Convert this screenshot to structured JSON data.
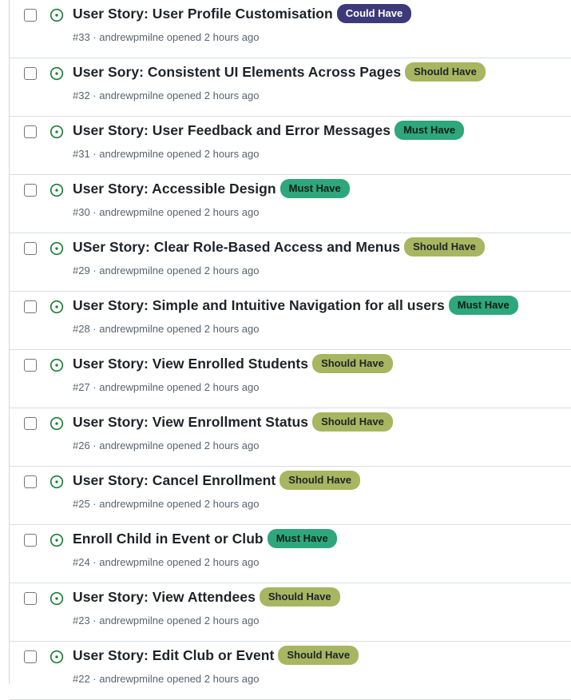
{
  "colors": {
    "open_icon": "#1a7f37",
    "label_could": "#3d3a7a",
    "label_should": "#a8b661",
    "label_must": "#2da77b"
  },
  "issues": [
    {
      "title": "User Story: User Profile Customisation",
      "label": "Could Have",
      "priority": "could",
      "meta": "#33 · andrewpmilne opened 2 hours ago"
    },
    {
      "title": "User Sory: Consistent UI Elements Across Pages",
      "label": "Should Have",
      "priority": "should",
      "meta": "#32 · andrewpmilne opened 2 hours ago"
    },
    {
      "title": "User Story: User Feedback and Error Messages",
      "label": "Must Have",
      "priority": "must",
      "meta": "#31 · andrewpmilne opened 2 hours ago"
    },
    {
      "title": "User Story: Accessible Design",
      "label": "Must Have",
      "priority": "must",
      "meta": "#30 · andrewpmilne opened 2 hours ago"
    },
    {
      "title": "USer Story: Clear Role-Based Access and Menus",
      "label": "Should Have",
      "priority": "should",
      "meta": "#29 · andrewpmilne opened 2 hours ago"
    },
    {
      "title": "User Story: Simple and Intuitive Navigation for all users",
      "label": "Must Have",
      "priority": "must",
      "meta": "#28 · andrewpmilne opened 2 hours ago"
    },
    {
      "title": "User Story: View Enrolled Students",
      "label": "Should Have",
      "priority": "should",
      "meta": "#27 · andrewpmilne opened 2 hours ago"
    },
    {
      "title": "User Story: View Enrollment Status",
      "label": "Should Have",
      "priority": "should",
      "meta": "#26 · andrewpmilne opened 2 hours ago"
    },
    {
      "title": "User Story: Cancel Enrollment",
      "label": "Should Have",
      "priority": "should",
      "meta": "#25 · andrewpmilne opened 2 hours ago"
    },
    {
      "title": "Enroll Child in Event or Club",
      "label": "Must Have",
      "priority": "must",
      "meta": "#24 · andrewpmilne opened 2 hours ago"
    },
    {
      "title": "User Story: View Attendees",
      "label": "Should Have",
      "priority": "should",
      "meta": "#23 · andrewpmilne opened 2 hours ago"
    },
    {
      "title": "User Story: Edit Club or Event",
      "label": "Should Have",
      "priority": "should",
      "meta": "#22 · andrewpmilne opened 2 hours ago"
    }
  ]
}
